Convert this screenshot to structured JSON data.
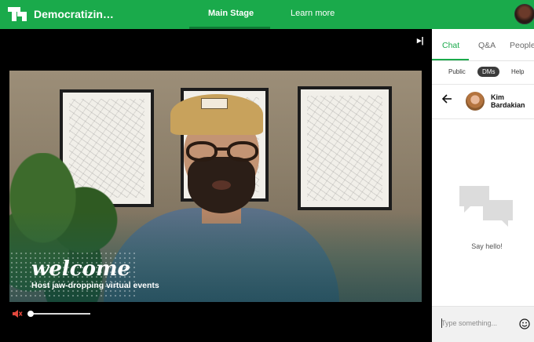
{
  "header": {
    "event_title": "Democratizin…",
    "logo_icon": "techcrunch-logo-icon",
    "tabs": [
      {
        "label": "Main Stage",
        "active": true
      },
      {
        "label": "Learn more",
        "active": false
      }
    ],
    "brand_color": "#1aaa4b"
  },
  "stage": {
    "collapse_icon": "collapse-panel-icon",
    "video": {
      "overlay_title": "welcome",
      "overlay_subtitle": "Host jaw-dropping virtual events"
    },
    "controls": {
      "mute_icon": "speaker-muted-icon",
      "progress_fraction": 0.02
    }
  },
  "panel": {
    "tabs": [
      {
        "label": "Chat",
        "active": true
      },
      {
        "label": "Q&A",
        "active": false
      },
      {
        "label": "People",
        "active": false
      }
    ],
    "subtabs": [
      {
        "label": "Public",
        "active": false
      },
      {
        "label": "DMs",
        "active": true
      },
      {
        "label": "Help",
        "active": false
      }
    ],
    "dm": {
      "back_icon": "back-arrow-icon",
      "contact_name": "Kim Bardakian"
    },
    "empty_state": {
      "icon": "chat-bubbles-icon",
      "text": "Say hello!"
    },
    "composer": {
      "placeholder": "Type something...",
      "value": "",
      "emoji_icon": "smiley-icon"
    }
  }
}
